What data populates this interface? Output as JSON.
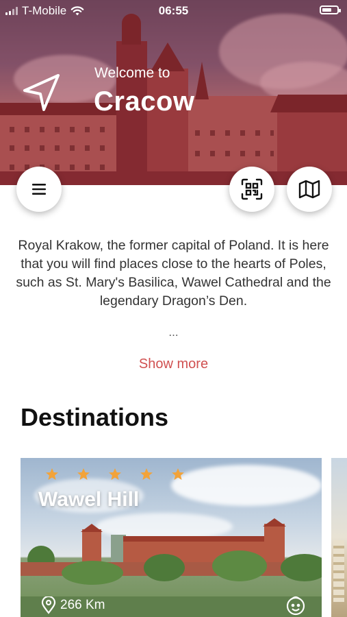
{
  "status_bar": {
    "carrier": "T-Mobile",
    "time": "06:55",
    "battery_level": 0.65
  },
  "hero": {
    "welcome": "Welcome to",
    "city": "Cracow"
  },
  "actions": {
    "menu_icon": "menu-icon",
    "qr_icon": "qr-scan-icon",
    "map_icon": "map-icon"
  },
  "description": {
    "text": "Royal Krakow, the former capital of Poland. It is here that you will find places close to the hearts of Poles, such as St. Mary's Basilica, Wawel Cathedral and the legendary Dragon’s Den.",
    "ellipsis": "...",
    "show_more": "Show more"
  },
  "destinations": {
    "title": "Destinations",
    "items": [
      {
        "name": "Wawel Hill",
        "rating": 5,
        "distance": "266 Km",
        "kid_icon": "kid-friendly-icon"
      }
    ]
  },
  "colors": {
    "accent": "#d05050",
    "star": "#f2a33a",
    "hero_tint": "#96242c"
  }
}
